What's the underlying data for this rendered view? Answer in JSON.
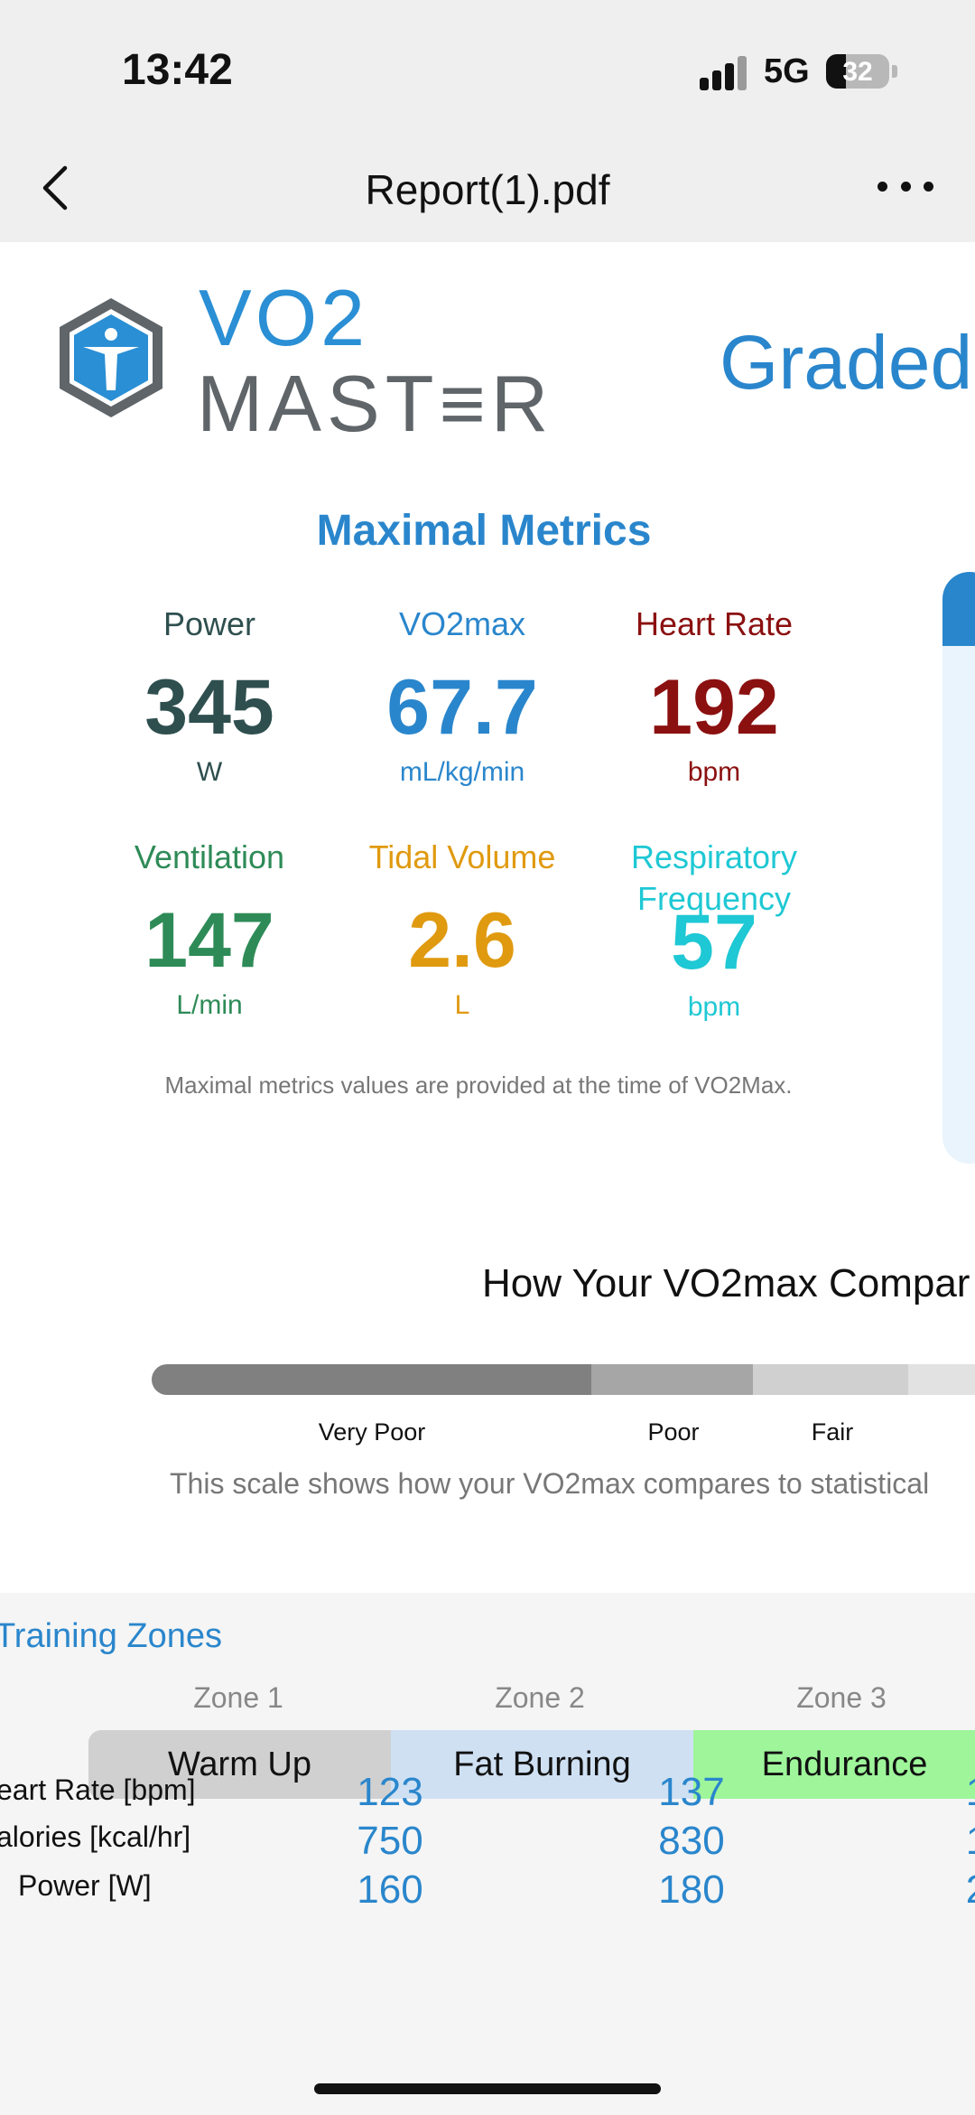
{
  "status_bar": {
    "time": "13:42",
    "network": "5G",
    "battery": "32"
  },
  "nav": {
    "title": "Report(1).pdf"
  },
  "brand": {
    "line1": "VO2",
    "line2": "MAST≡R",
    "report_title": "Graded"
  },
  "maximal_metrics": {
    "title": "Maximal Metrics",
    "items": [
      {
        "label": "Power",
        "value": "345",
        "unit": "W",
        "color": "#2f4f4f"
      },
      {
        "label": "VO2max",
        "value": "67.7",
        "unit": "mL/kg/min",
        "color": "#2a86cc"
      },
      {
        "label": "Heart Rate",
        "value": "192",
        "unit": "bpm",
        "color": "#8b1010"
      },
      {
        "label": "Ventilation",
        "value": "147",
        "unit": "L/min",
        "color": "#2e8b57"
      },
      {
        "label": "Tidal Volume",
        "value": "2.6",
        "unit": "L",
        "color": "#e09a10"
      },
      {
        "label": "Respiratory\nFrequency",
        "value": "57",
        "unit": "bpm",
        "color": "#1ec8d4"
      }
    ],
    "note": "Maximal metrics values are provided at the time of VO2Max."
  },
  "comparison": {
    "title": "How Your VO2max Compar",
    "scale_labels": [
      "Very Poor",
      "Poor",
      "Fair"
    ],
    "scale_colors": [
      "#808080",
      "#a6a6a6",
      "#d0d0d0",
      "#e2e2e2"
    ],
    "note": "This scale shows how your VO2max compares to statistical"
  },
  "training_zones": {
    "title": "Training Zones",
    "zones": [
      {
        "number": "Zone 1",
        "name": "Warm Up",
        "color": "#d0d0d0"
      },
      {
        "number": "Zone 2",
        "name": "Fat Burning",
        "color": "#cfe0f3"
      },
      {
        "number": "Zone 3",
        "name": "Endurance",
        "color": "#9ef59a"
      }
    ],
    "rows": [
      {
        "label": "eart Rate [bpm]",
        "values": [
          "123",
          "137",
          "1"
        ]
      },
      {
        "label": "alories [kcal/hr]",
        "values": [
          "750",
          "830",
          "1"
        ]
      },
      {
        "label": "Power [W]",
        "values": [
          "160",
          "180",
          "2"
        ]
      }
    ]
  }
}
